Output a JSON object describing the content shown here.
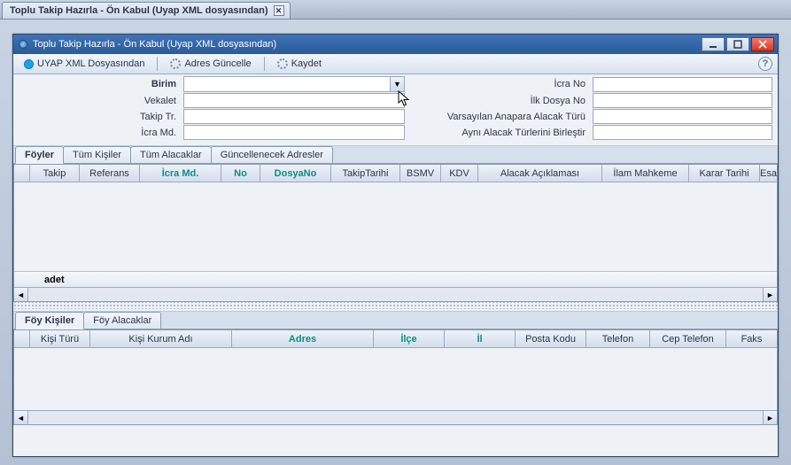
{
  "outerTab": {
    "title": "Toplu Takip Hazırla - Ön Kabul (Uyap XML dosyasından)"
  },
  "mdi": {
    "title": "Toplu Takip Hazırla - Ön Kabul (Uyap XML dosyasından)"
  },
  "toolbar": {
    "uyap": "UYAP XML Dosyasından",
    "adres": "Adres Güncelle",
    "kaydet": "Kaydet"
  },
  "form": {
    "left": {
      "birim": "Birim",
      "vekalet": "Vekalet",
      "takiptr": "Takip Tr.",
      "icramd": "İcra Md."
    },
    "right": {
      "icrano": "İcra No",
      "ilkdosyano": "İlk Dosya No",
      "varsayilan": "Varsayılan Anapara Alacak Türü",
      "birlestir": "Aynı Alacak Türlerini Birleştir"
    },
    "values": {
      "birim": "",
      "vekalet": "",
      "takiptr": "",
      "icramd": "",
      "icrano": "",
      "ilkdosyano": "",
      "varsayilan": "",
      "birlestir": ""
    }
  },
  "tabs1": {
    "foyler": "Föyler",
    "tumkisiler": "Tüm Kişiler",
    "tumalacaklar": "Tüm Alacaklar",
    "guncellenecek": "Güncellenecek Adresler"
  },
  "grid1cols": {
    "takip": "Takip",
    "referans": "Referans",
    "icramd": "İcra Md.",
    "no": "No",
    "dosyano": "DosyaNo",
    "takiptarihi": "TakipTarihi",
    "bsmv": "BSMV",
    "kdv": "KDV",
    "alacak": "Alacak Açıklaması",
    "ilam": "İlam Mahkeme",
    "karar": "Karar Tarihi",
    "esa": "Esa"
  },
  "grid1footer": "adet",
  "tabs2": {
    "foykisiler": "Föy Kişiler",
    "foyalacaklar": "Föy Alacaklar"
  },
  "grid2cols": {
    "kisituru": "Kişi Türü",
    "kisikurum": "Kişi Kurum Adı",
    "adres": "Adres",
    "ilce": "İlçe",
    "il": "İl",
    "postakodu": "Posta Kodu",
    "telefon": "Telefon",
    "ceptelefon": "Cep Telefon",
    "faks": "Faks"
  }
}
